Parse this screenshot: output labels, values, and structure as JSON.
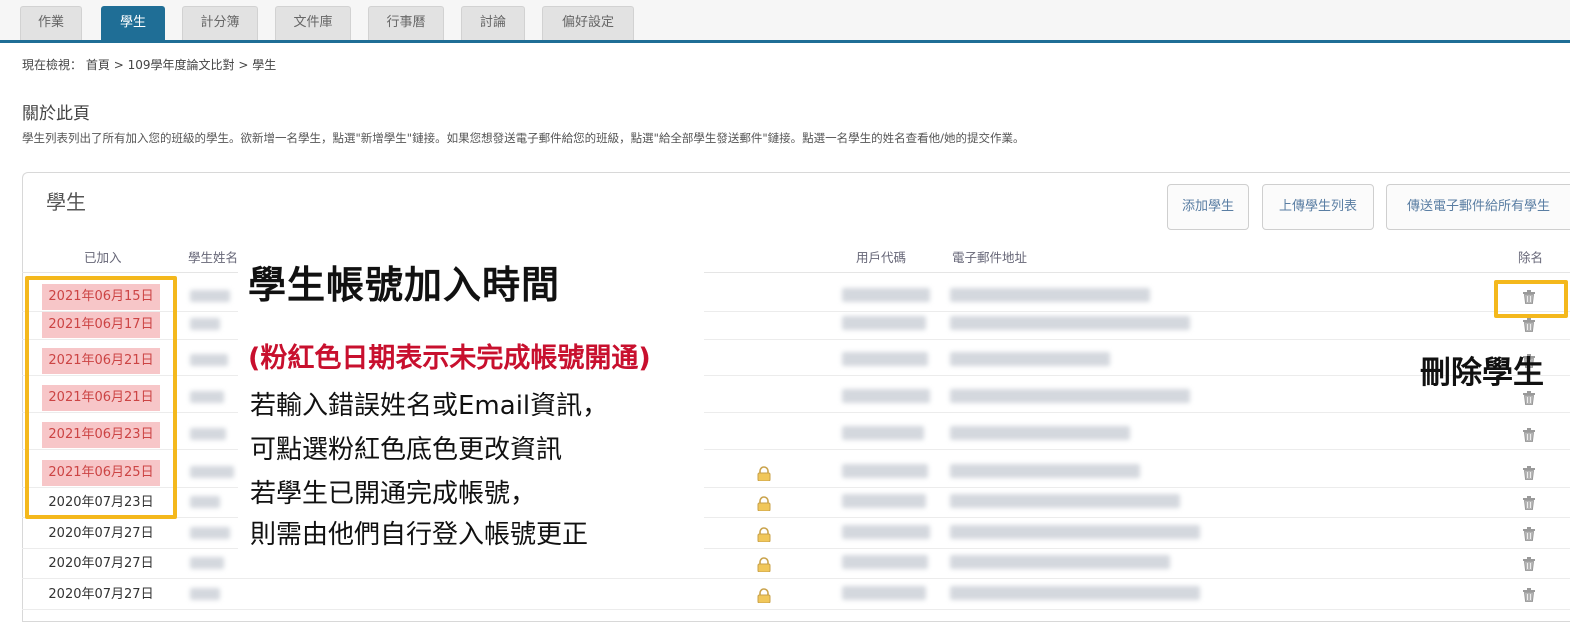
{
  "tabs": [
    "作業",
    "學生",
    "計分簿",
    "文件庫",
    "行事曆",
    "討論",
    "偏好設定"
  ],
  "breadcrumb": {
    "prefix": "現在檢視：",
    "home": "首頁",
    "sep": ">",
    "course": "109學年度論文比對",
    "current": "學生"
  },
  "about": {
    "title": "關於此頁",
    "text": "學生列表列出了所有加入您的班級的學生。欲新增一名學生，點選\"新增學生\"鏈接。如果您想發送電子郵件給您的班級，點選\"給全部學生發送郵件\"鏈接。點選一名學生的姓名查看他/她的提交作業。"
  },
  "panel": {
    "title": "學生",
    "buttons": {
      "add": "添加學生",
      "upload": "上傳學生列表",
      "email_all": "傳送電子郵件給所有學生"
    }
  },
  "table": {
    "headers": {
      "joined": "已加入",
      "name": "學生姓名",
      "user_id": "用戶代碼",
      "email": "電子郵件地址",
      "remove": "除名"
    },
    "rows": [
      {
        "joined": "2021年06月15日",
        "pending": true,
        "locked": false
      },
      {
        "joined": "2021年06月17日",
        "pending": true,
        "locked": false
      },
      {
        "joined": "2021年06月21日",
        "pending": true,
        "locked": false
      },
      {
        "joined": "2021年06月21日",
        "pending": true,
        "locked": false
      },
      {
        "joined": "2021年06月23日",
        "pending": true,
        "locked": false
      },
      {
        "joined": "2021年06月25日",
        "pending": true,
        "locked": true
      },
      {
        "joined": "2020年07月23日",
        "pending": false,
        "locked": true
      },
      {
        "joined": "2020年07月27日",
        "pending": false,
        "locked": true
      },
      {
        "joined": "2020年07月27日",
        "pending": false,
        "locked": true
      },
      {
        "joined": "2020年07月27日",
        "pending": false,
        "locked": true
      }
    ]
  },
  "annotation": {
    "headline": "學生帳號加入時間",
    "red_note": "(粉紅色日期表示未完成帳號開通)",
    "lines": [
      "若輸入錯誤姓名或Email資訊，",
      "可點選粉紅色底色更改資訊",
      "若學生已開通完成帳號，",
      "則需由他們自行登入帳號更正"
    ],
    "delete_label": "刪除學生"
  },
  "colors": {
    "tab_active": "#1f6e96",
    "pending_bg": "#f7c6c8",
    "highlight": "#f4b81c",
    "red_text": "#c8102e"
  }
}
